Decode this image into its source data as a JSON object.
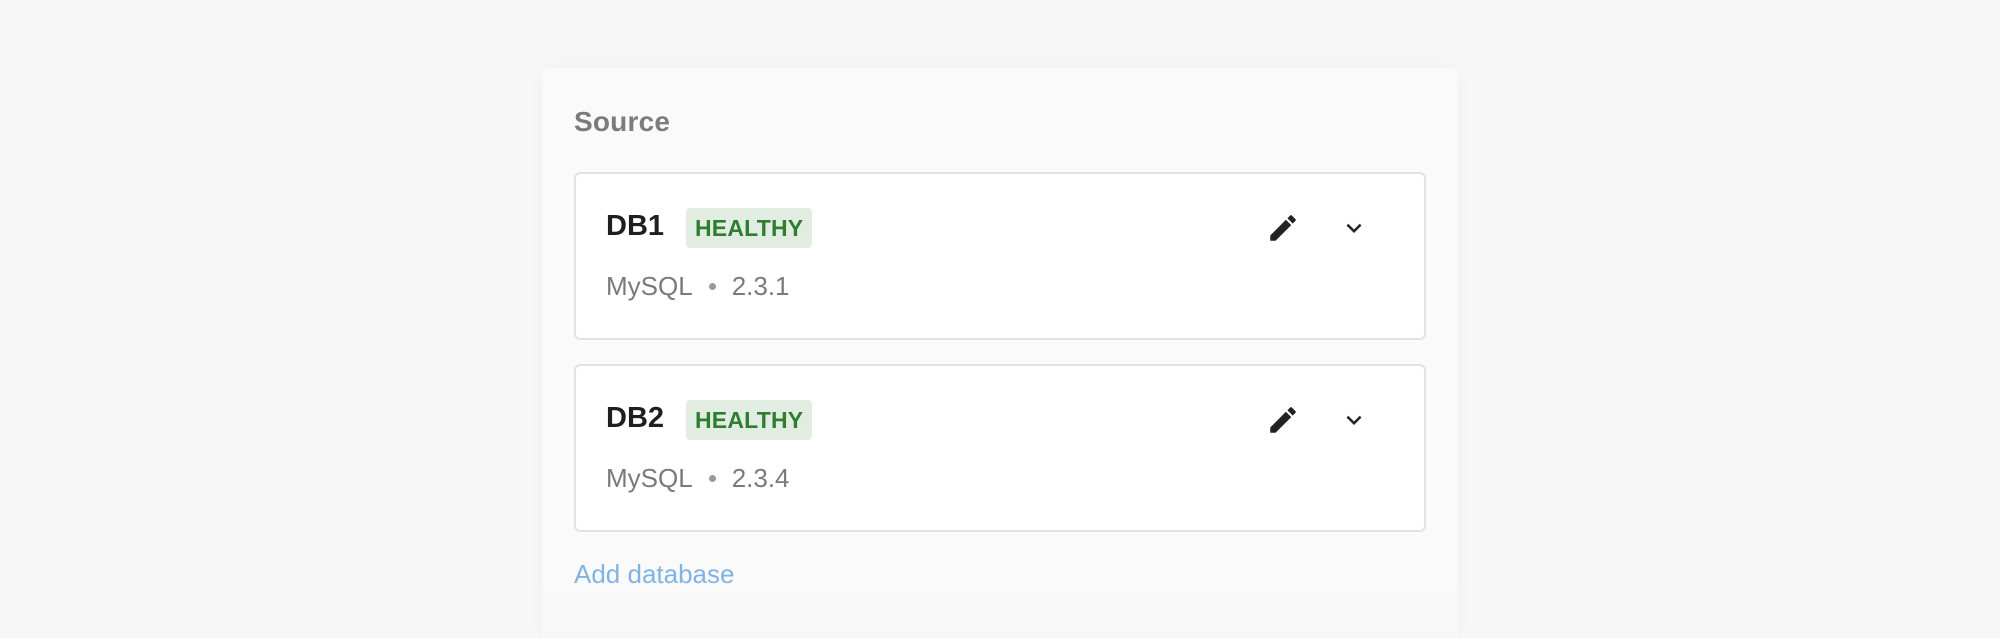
{
  "source": {
    "title": "Source",
    "databases": [
      {
        "name": "DB1",
        "status": "HEALTHY",
        "engine": "MySQL",
        "version": "2.3.1"
      },
      {
        "name": "DB2",
        "status": "HEALTHY",
        "engine": "MySQL",
        "version": "2.3.4"
      }
    ],
    "add_label": "Add database"
  },
  "colors": {
    "healthy_text": "#2f7d32",
    "healthy_bg": "#e2ede2",
    "link": "#7fb2e5"
  },
  "icons": {
    "edit": "pencil-icon",
    "expand": "chevron-down-icon"
  }
}
